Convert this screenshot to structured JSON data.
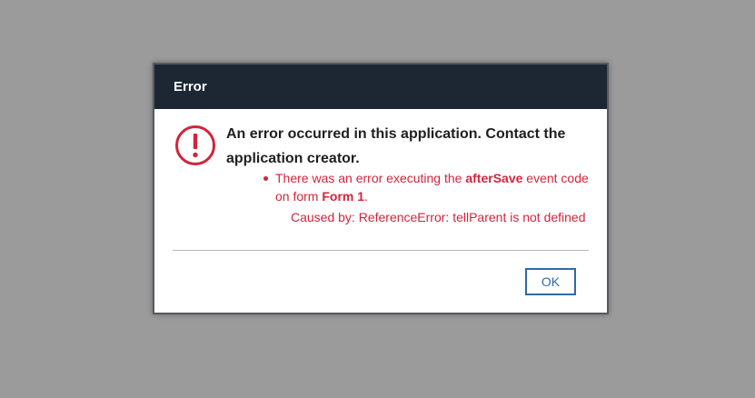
{
  "dialog": {
    "title": "Error",
    "icon": "exclamation-circle-icon",
    "message": "An error occurred in this application. Contact the application creator.",
    "detail": {
      "prefix": "There was an error executing the ",
      "event_name": "afterSave",
      "middle": " event code on form ",
      "form_name": "Form 1",
      "suffix": "."
    },
    "caused_by": "Caused by: ReferenceError: tellParent is not defined",
    "ok_label": "OK"
  },
  "colors": {
    "overlay": "#9b9b9b",
    "header_bg": "#1c2733",
    "error_red": "#d0253b",
    "button_blue": "#2b6ca8"
  }
}
